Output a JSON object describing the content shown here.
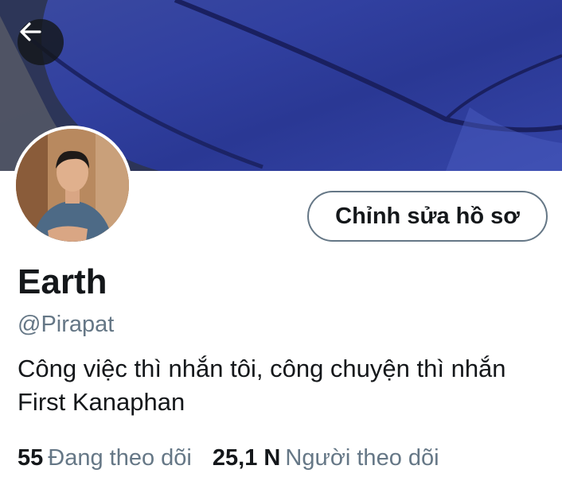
{
  "profile": {
    "name": "Earth",
    "handle": "@Pirapat",
    "bio": "Công việc thì nhắn tôi, công chuyện thì nhắn First Kanaphan",
    "edit_button_label": "Chỉnh sửa hồ sơ"
  },
  "stats": {
    "following_count": "55",
    "following_label": "Đang theo dõi",
    "followers_count": "25,1 N",
    "followers_label": "Người theo dõi"
  },
  "icons": {
    "back": "arrow-left-icon"
  },
  "colors": {
    "text_primary": "#14171a",
    "text_secondary": "#657786",
    "banner": "#3140a0",
    "button_border": "#657786"
  }
}
